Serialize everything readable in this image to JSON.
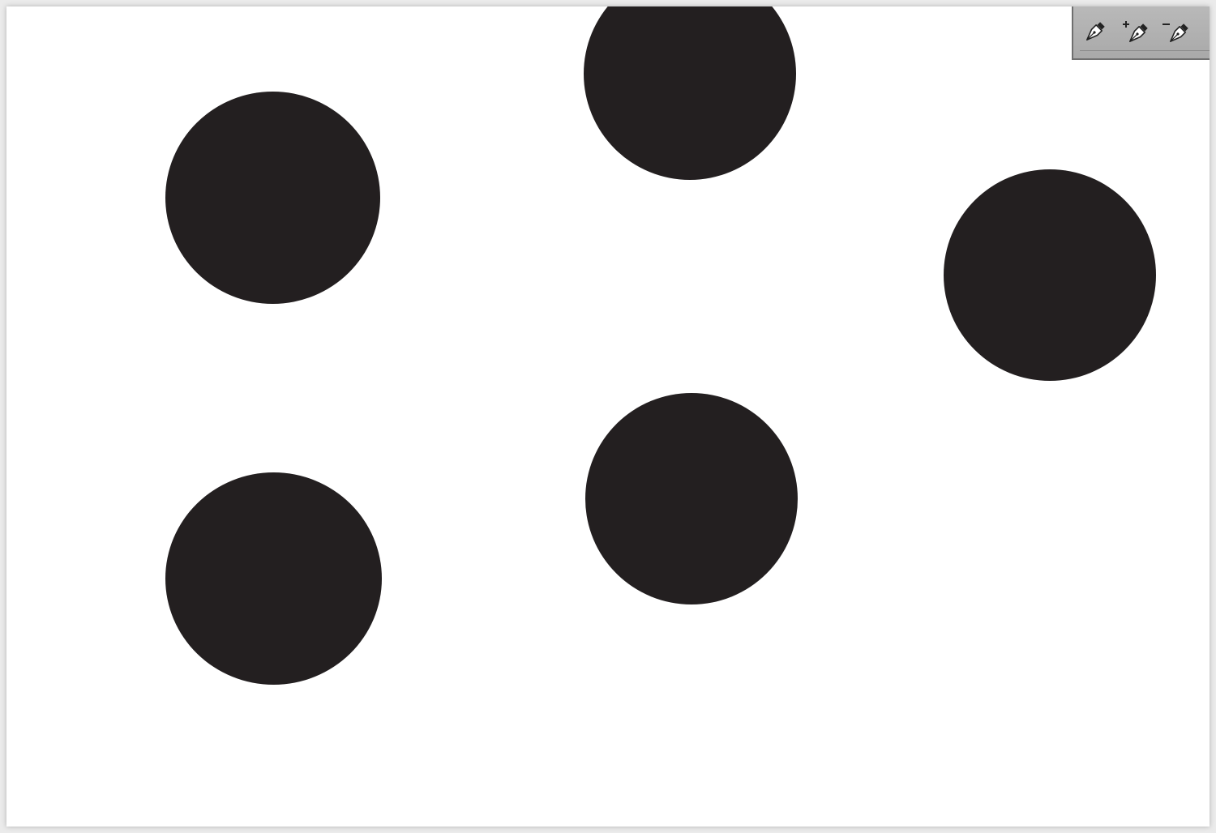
{
  "canvas": {
    "background_color": "#ffffff",
    "shape_fill_color": "#231f20",
    "shapes": [
      {
        "kind": "circle"
      },
      {
        "kind": "circle"
      },
      {
        "kind": "circle"
      },
      {
        "kind": "circle"
      },
      {
        "kind": "circle"
      }
    ]
  },
  "tool_panel": {
    "background_color": "#b0b0b0",
    "tools": [
      {
        "icon": "pen-tool-icon"
      },
      {
        "icon": "add-anchor-point-icon"
      },
      {
        "icon": "delete-anchor-point-icon"
      }
    ]
  }
}
